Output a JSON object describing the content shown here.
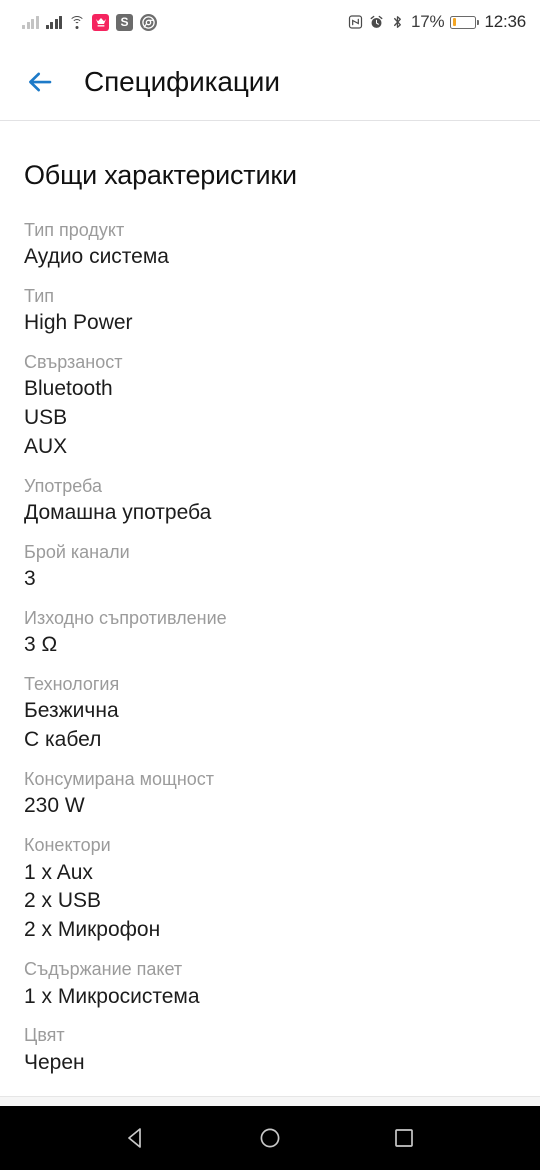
{
  "status_bar": {
    "icons": [
      "signal-bars-dim",
      "signal-bars",
      "wifi-icon",
      "shopping-app-icon",
      "s-app-icon",
      "chrome-app-icon",
      "nfc-icon",
      "alarm-icon",
      "bluetooth-icon"
    ],
    "s_app_letter": "S",
    "battery_percent": "17%",
    "battery_level": 17,
    "time": "12:36"
  },
  "app_bar": {
    "back_icon": "arrow-left-icon",
    "title": "Спецификации",
    "accent_color": "#1d7ac8"
  },
  "content": {
    "section_title": "Общи характеристики",
    "specs": [
      {
        "label": "Тип продукт",
        "value": "Аудио система"
      },
      {
        "label": "Тип",
        "value": "High Power"
      },
      {
        "label": "Свързаност",
        "value": "Bluetooth\nUSB\nAUX"
      },
      {
        "label": "Употреба",
        "value": "Домашна употреба"
      },
      {
        "label": "Брой канали",
        "value": "3"
      },
      {
        "label": "Изходно съпротивление",
        "value": "3 Ω"
      },
      {
        "label": "Технология",
        "value": "Безжична\nС кабел"
      },
      {
        "label": "Консумирана мощност",
        "value": "230 W"
      },
      {
        "label": "Конектори",
        "value": "1 x Aux\n2 x USB\n2 x Микрофон"
      },
      {
        "label": "Съдържание пакет",
        "value": "1 x Микросистема"
      },
      {
        "label": "Цвят",
        "value": "Черен"
      }
    ]
  },
  "navigation_bar": {
    "back": "nav-back-icon",
    "home": "nav-home-icon",
    "recents": "nav-recents-icon"
  }
}
